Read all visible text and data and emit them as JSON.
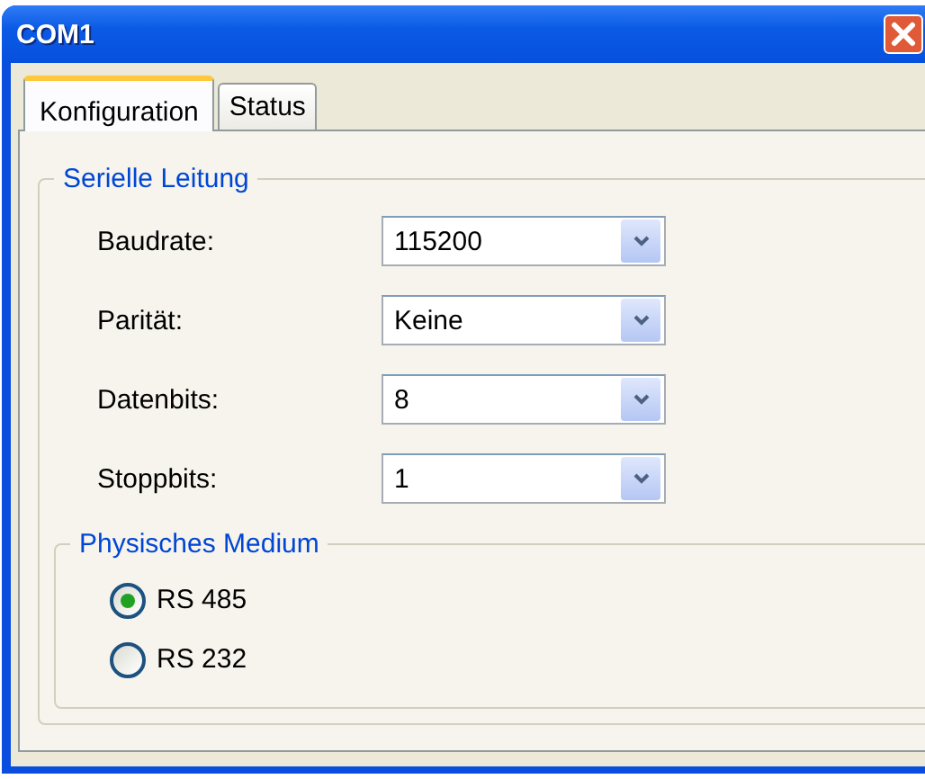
{
  "window": {
    "title": "COM1"
  },
  "tabs": [
    {
      "label": "Konfiguration",
      "selected": true
    },
    {
      "label": "Status",
      "selected": false
    }
  ],
  "serial_group": {
    "title": "Serielle Leitung",
    "fields": [
      {
        "label": "Baudrate:",
        "value": "115200"
      },
      {
        "label": "Parität:",
        "value": "Keine"
      },
      {
        "label": "Datenbits:",
        "value": "8"
      },
      {
        "label": "Stoppbits:",
        "value": "1"
      }
    ]
  },
  "medium_group": {
    "title": "Physisches Medium",
    "options": [
      {
        "label": "RS 485",
        "selected": true
      },
      {
        "label": "RS 232",
        "selected": false
      }
    ]
  }
}
